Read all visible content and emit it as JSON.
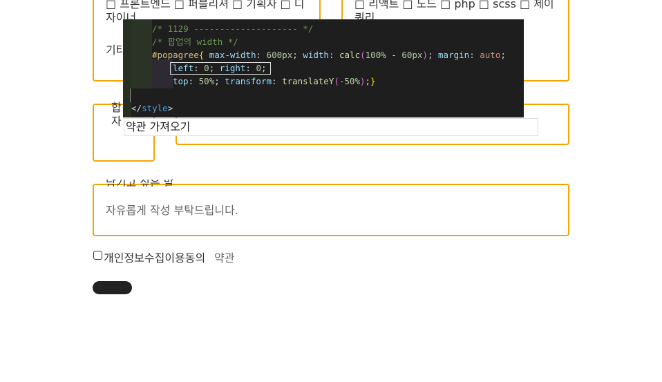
{
  "form": {
    "top_left_line1": "□ 프론트엔드 □ 퍼블리셔 □ 기획자 □ 디",
    "top_left_line2": "자이너",
    "top_left_line3": "기타",
    "top_right_line1": "□ 리액트 □ 노드 □ php □ scss □ 제이",
    "top_right_line2": "쿼리",
    "left_small_label1": "합",
    "left_small_label2": "자",
    "memo_label": "남기고 싶은 말",
    "memo_placeholder": "자유롭게 작성 부탁드립니다.",
    "consent_label": "개인정보수집이용동의",
    "consent_link": "약관"
  },
  "popup": {
    "fetch_terms": "약관 가져오기"
  },
  "code": {
    "line1": "/* 1129 -------------------- */",
    "line2": "/* 팝업의 width */",
    "selector": "#popagree",
    "decl1_prop": "max-width",
    "decl1_val": "600px",
    "decl2_prop": "width",
    "decl2_fn": "calc",
    "decl2_arg1": "100%",
    "decl2_op": " - ",
    "decl2_arg2": "60px",
    "decl3_prop": "margin",
    "decl3_val": "auto",
    "left_prop": "left",
    "left_val": "0",
    "right_prop": "right",
    "right_val": "0",
    "top_prop": "top",
    "top_val": "50%",
    "transform_prop": "transform",
    "transform_fn": "translateY",
    "transform_arg": "-50%",
    "close_tag": "style"
  }
}
